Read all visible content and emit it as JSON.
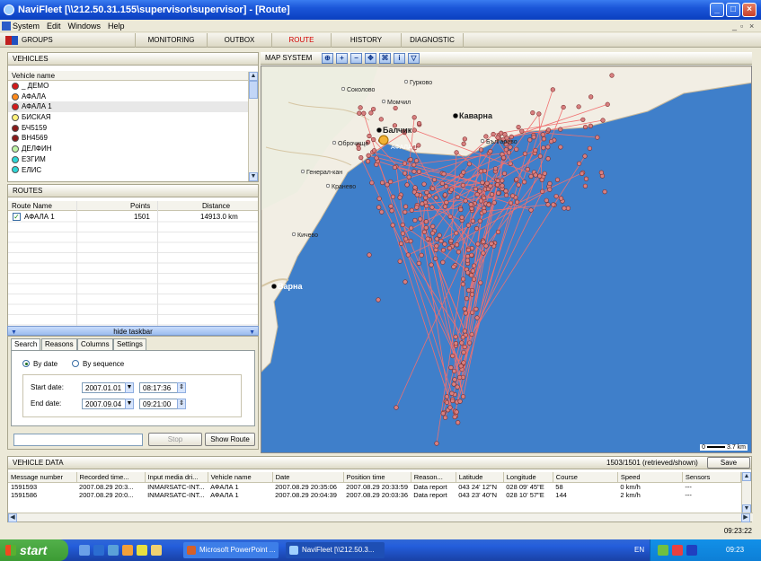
{
  "window": {
    "title": "NaviFleet [\\\\212.50.31.155\\supervisor\\supervisor] - [Route]"
  },
  "menu": {
    "items": [
      "System",
      "Edit",
      "Windows",
      "Help"
    ]
  },
  "nav": {
    "groups": "GROUPS",
    "tabs": [
      "MONITORING",
      "OUTBOX",
      "ROUTE",
      "HISTORY",
      "DIAGNOSTIC"
    ],
    "active_tab": "ROUTE"
  },
  "vehicles": {
    "header": "VEHICLES",
    "column": "Vehicle name",
    "items": [
      {
        "name": "_ ДЕМО",
        "color": "#d41a1a"
      },
      {
        "name": "АФАЛА",
        "color": "#ff8a1a"
      },
      {
        "name": "АФАЛА 1",
        "color": "#d41a1a"
      },
      {
        "name": "БИСКАЯ",
        "color": "#fff27a"
      },
      {
        "name": "БЧ5159",
        "color": "#8a1a1a"
      },
      {
        "name": "ВН4569",
        "color": "#8a1a1a"
      },
      {
        "name": "ДЕЛФИН",
        "color": "#bff5a6"
      },
      {
        "name": "ЕЗГИМ",
        "color": "#2ed6d6"
      },
      {
        "name": "ЕЛИС",
        "color": "#2ed6d6"
      }
    ],
    "selected_index": 2
  },
  "routes": {
    "header": "ROUTES",
    "columns": [
      "Route Name",
      "Points",
      "Distance"
    ],
    "rows": [
      {
        "name": "АФАЛА 1",
        "points": "1501",
        "distance": "14913.0 km",
        "checked": true
      }
    ]
  },
  "taskbar_toggle": "hide taskbar",
  "search": {
    "tabs": [
      "Search",
      "Reasons",
      "Columns",
      "Settings"
    ],
    "active_tab": "Search",
    "by_date": "By date",
    "by_sequence": "By sequence",
    "start_label": "Start date:",
    "end_label": "End date:",
    "start_date": "2007.01.01",
    "start_time": "08:17:36",
    "end_date": "2007.09.04",
    "end_time": "09:21:00",
    "stop": "Stop",
    "show_route": "Show Route"
  },
  "map": {
    "header": "MAP SYSTEM",
    "tools": [
      "zoom-fit",
      "zoom-in",
      "zoom-out",
      "pan",
      "full-extent",
      "info",
      "filter"
    ],
    "places": [
      {
        "name": "Гурково"
      },
      {
        "name": "Соколово"
      },
      {
        "name": "Момчил"
      },
      {
        "name": "Каварна"
      },
      {
        "name": "Балчик"
      },
      {
        "name": "Оброчище"
      },
      {
        "name": "Българево"
      },
      {
        "name": "Генерал-кан"
      },
      {
        "name": "Кранево"
      },
      {
        "name": "Кичево"
      },
      {
        "name": "Варна"
      }
    ],
    "vehicle_label": "АФАЛА 1",
    "scale_left": "0",
    "scale_right": "3.7 km",
    "colors": {
      "sea": "#3f7fca",
      "land": "#f2eee4",
      "route": "#f07070",
      "point": "#d88080"
    }
  },
  "vehicle_data": {
    "header": "VEHICLE DATA",
    "count": "1503/1501 (retrieved/shown)",
    "save": "Save",
    "columns": [
      "Message number",
      "Recorded time...",
      "Input media dri...",
      "Vehicle name",
      "Date",
      "Position time",
      "Reason...",
      "Latitude",
      "Longitude",
      "Course",
      "Speed",
      "Sensors"
    ],
    "rows": [
      [
        "1591593",
        "2007.08.29 20:3...",
        "INMARSATC-INT...",
        "АФАЛА 1",
        "2007.08.29 20:35:06",
        "2007.08.29 20:33:59",
        "Data report",
        "043 24' 12\"N",
        "028 09' 45\"E",
        "58",
        "0 km/h",
        "---"
      ],
      [
        "1591586",
        "2007.08.29 20:0...",
        "INMARSATC-INT...",
        "АФАЛА 1",
        "2007.08.29 20:04:39",
        "2007.08.29 20:03:36",
        "Data report",
        "043 23' 40\"N",
        "028 10' 57\"E",
        "144",
        "2 km/h",
        "---"
      ]
    ]
  },
  "status_time": "09:23:22",
  "taskbar": {
    "start": "start",
    "tasks": [
      "Microsoft PowerPoint ...",
      "NaviFleet [\\\\212.50.3..."
    ],
    "lang": "EN",
    "clock": "09:23"
  }
}
